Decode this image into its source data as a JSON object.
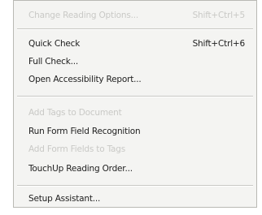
{
  "menu": {
    "items": [
      {
        "label": "Change Reading Options...",
        "shortcut": "Shift+Ctrl+5",
        "disabled": true
      },
      {
        "label": "Quick Check",
        "shortcut": "Shift+Ctrl+6",
        "disabled": false
      },
      {
        "label": "Full Check...",
        "shortcut": "",
        "disabled": false
      },
      {
        "label": "Open Accessibility Report...",
        "shortcut": "",
        "disabled": false
      },
      {
        "label": "Add Tags to Document",
        "shortcut": "",
        "disabled": true
      },
      {
        "label": "Run Form Field Recognition",
        "shortcut": "",
        "disabled": false
      },
      {
        "label": "Add Form Fields to Tags",
        "shortcut": "",
        "disabled": true
      },
      {
        "label": "TouchUp Reading Order...",
        "shortcut": "",
        "disabled": false
      },
      {
        "label": "Setup Assistant...",
        "shortcut": "",
        "disabled": false
      }
    ]
  }
}
